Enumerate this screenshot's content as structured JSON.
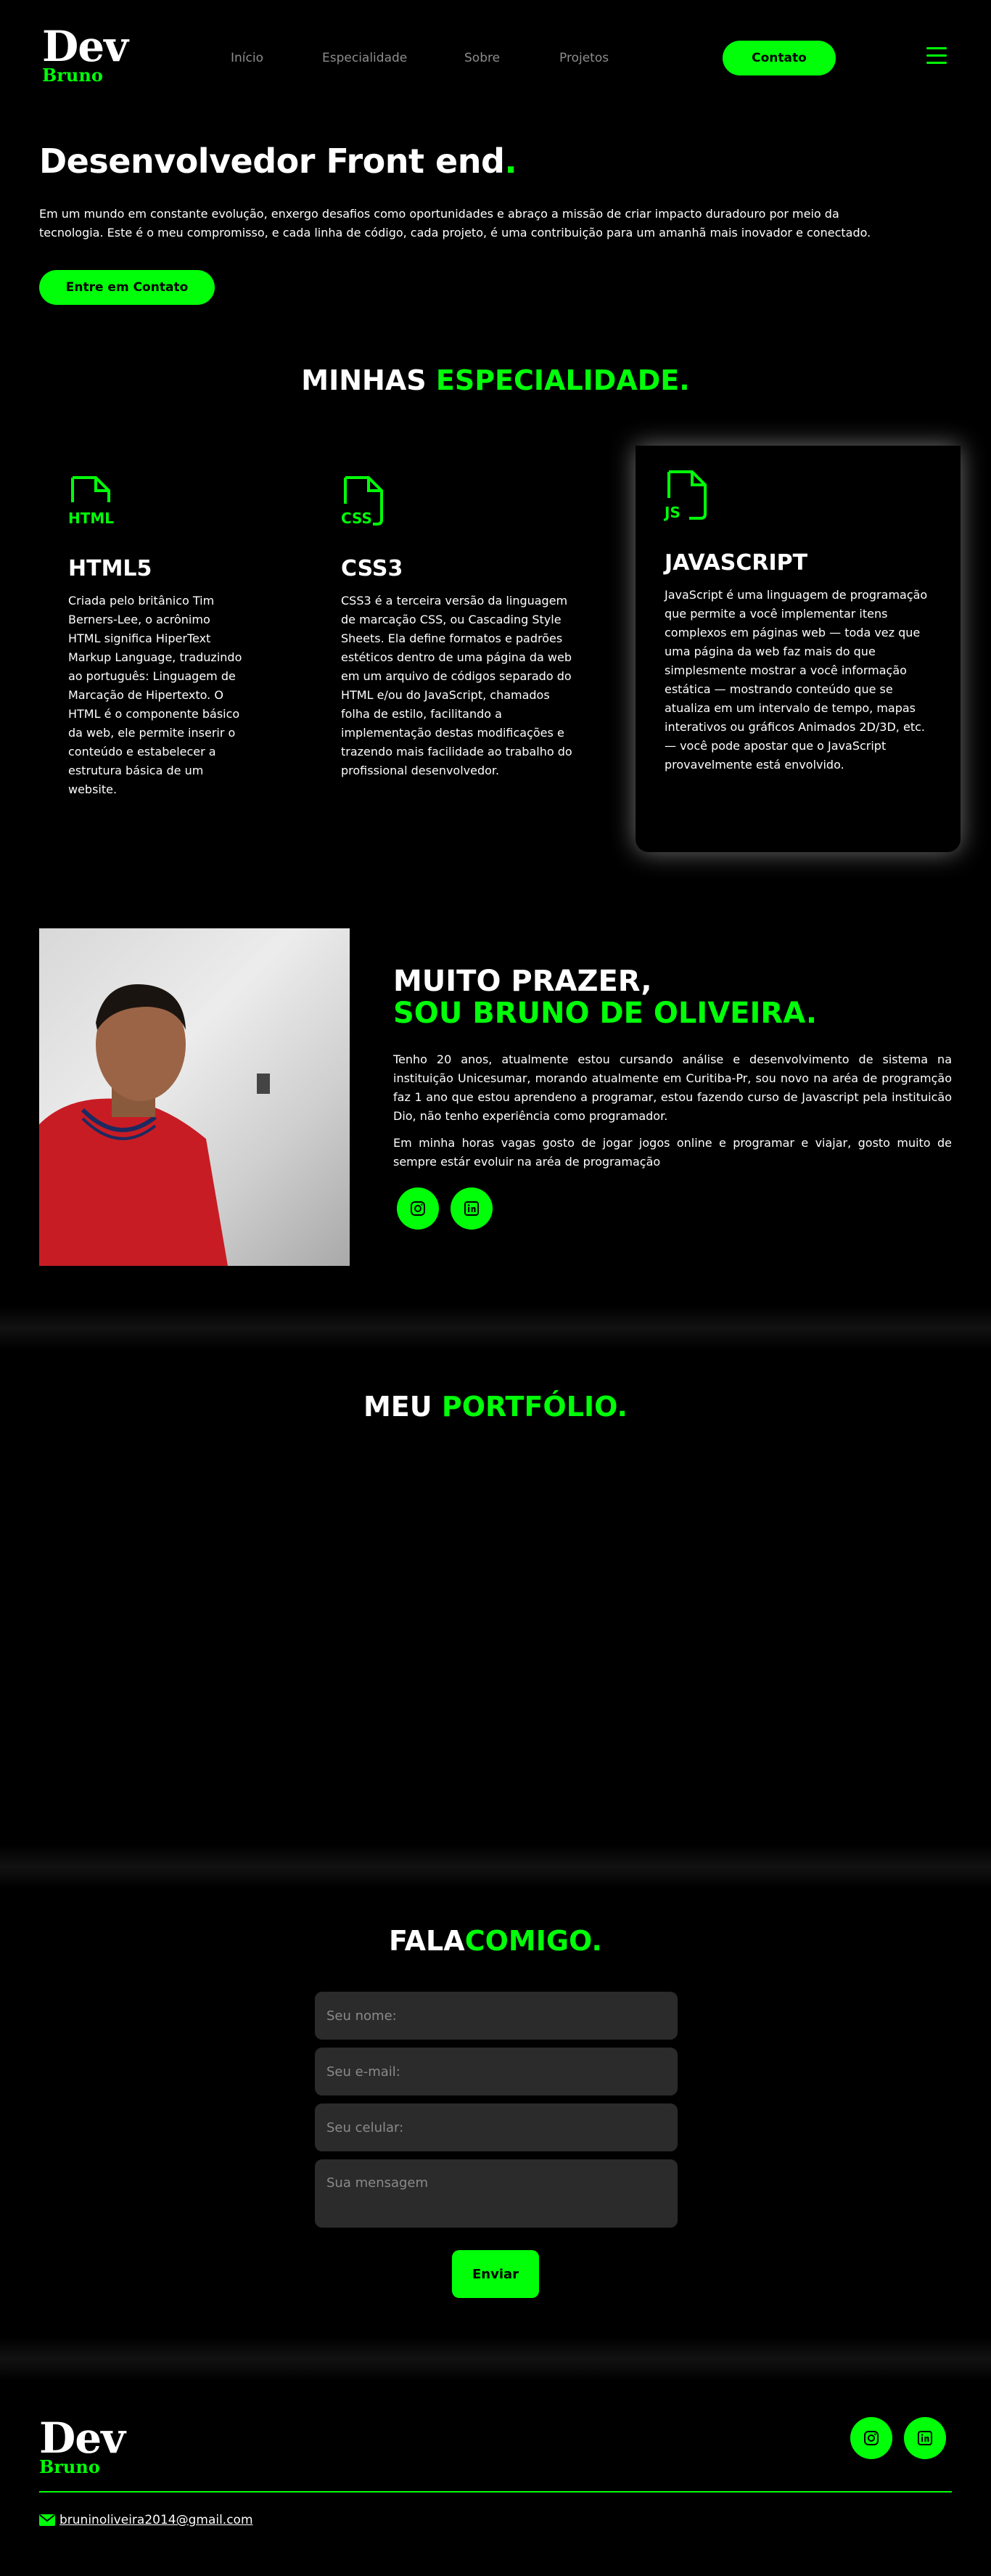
{
  "logo": {
    "main": "Dev",
    "sub": "Bruno"
  },
  "nav": {
    "items": [
      "Início",
      "Especialidade",
      "Sobre",
      "Projetos"
    ],
    "cta": "Contato"
  },
  "hero": {
    "title": "Desenvolvedor Front end",
    "title_dot": ".",
    "text": "Em um mundo em constante evolução, enxergo desafios como oportunidades e abraço a missão de criar impacto duradouro por meio da tecnologia. Este é o meu compromisso, e cada linha de código, cada projeto, é uma contribuição para um amanhã mais inovador e conectado.",
    "button": "Entre em Contato"
  },
  "specialties": {
    "title_a": "MINHAS ",
    "title_b": "ESPECIALIDADE.",
    "cards": [
      {
        "icon_label": "HTML",
        "title": "HTML5",
        "text": "Criada pelo britânico Tim Berners-Lee, o acrônimo HTML significa HiperText Markup Language, traduzindo ao português: Linguagem de Marcação de Hipertexto. O HTML é o componente básico da web, ele permite inserir o conteúdo e estabelecer a estrutura básica de um website."
      },
      {
        "icon_label": "CSS",
        "title": "CSS3",
        "text": "CSS3 é a terceira versão da linguagem de marcação CSS, ou Cascading Style Sheets. Ela define formatos e padrões estéticos dentro de uma página da web em um arquivo de códigos separado do HTML e/ou do JavaScript, chamados folha de estilo, facilitando a implementação destas modificações e trazendo mais facilidade ao trabalho do profissional desenvolvedor."
      },
      {
        "icon_label": "JS",
        "title": "JAVASCRIPT",
        "text": "JavaScript é uma linguagem de programação que permite a você implementar itens complexos em páginas web — toda vez que uma página da web faz mais do que simplesmente mostrar a você informação estática — mostrando conteúdo que se atualiza em um intervalo de tempo, mapas interativos ou gráficos Animados 2D/3D, etc. — você pode apostar que o JavaScript provavelmente está envolvido."
      }
    ]
  },
  "about": {
    "heading_a": "MUITO PRAZER,",
    "heading_b": "SOU BRUNO DE OLIVEIRA.",
    "p1": "Tenho 20 anos, atualmente estou cursando análise e desenvolvimento de sistema na instituição Unicesumar, morando atualmente em Curitiba-Pr, sou novo na aréa de programção faz 1 ano que estou aprendeno a programar, estou fazendo curso de Javascript pela instituicão Dio, não tenho experiência como programador.",
    "p2": "Em minha horas vagas gosto de jogar jogos online e programar e viajar, gosto muito de sempre estár evoluir na aréa de programação"
  },
  "portfolio": {
    "title_a": "MEU ",
    "title_b": "PORTFÓLIO."
  },
  "contact": {
    "title_a": "FALA",
    "title_b": "COMIGO.",
    "name_placeholder": "Seu nome:",
    "email_placeholder": "Seu e-mail:",
    "phone_placeholder": "Seu celular:",
    "message_placeholder": "Sua mensagem",
    "submit": "Enviar"
  },
  "footer": {
    "email": "bruninoliveira2014@gmail.com"
  },
  "colors": {
    "accent": "#00ff08",
    "background": "#000000",
    "field": "#2b2b2b"
  }
}
